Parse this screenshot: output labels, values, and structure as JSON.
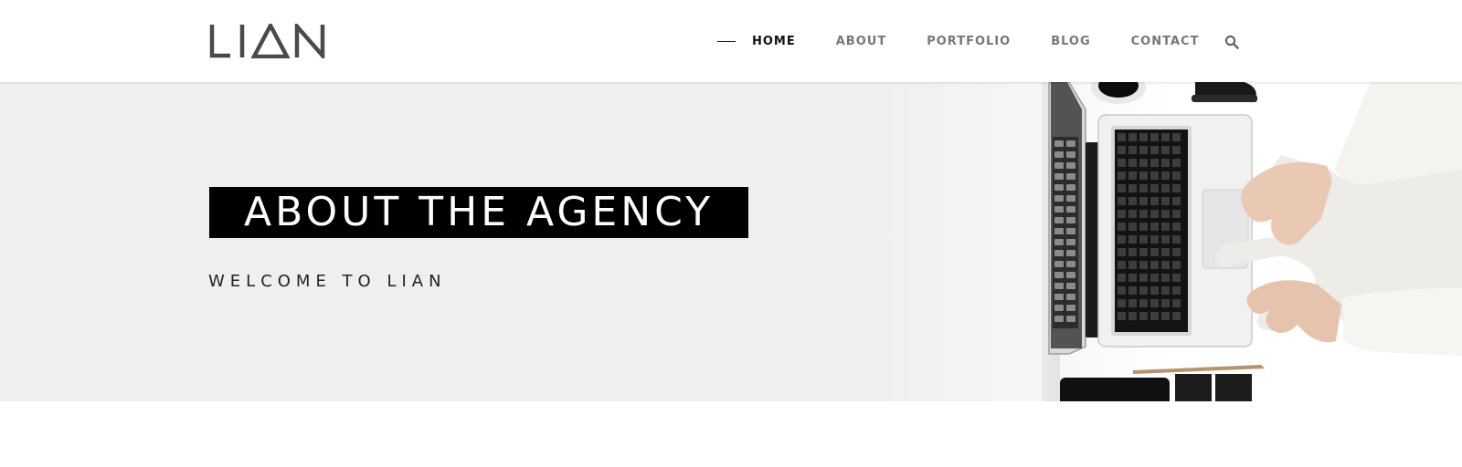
{
  "brand": {
    "logo_text": "LIAN"
  },
  "nav": {
    "items": [
      {
        "label": "HOME",
        "active": true
      },
      {
        "label": "ABOUT",
        "active": false
      },
      {
        "label": "PORTFOLIO",
        "active": false
      },
      {
        "label": "BLOG",
        "active": false
      },
      {
        "label": "CONTACT",
        "active": false
      }
    ],
    "search_icon": "search-icon"
  },
  "hero": {
    "title": "ABOUT THE AGENCY",
    "subtitle": "WELCOME TO LIAN",
    "image": "laptop-hands-desk-photo"
  },
  "colors": {
    "hero_bg": "#efeff1",
    "title_box": "#000000",
    "nav_active": "#111111",
    "nav_inactive": "#777777",
    "logo": "#4a4a4a"
  }
}
